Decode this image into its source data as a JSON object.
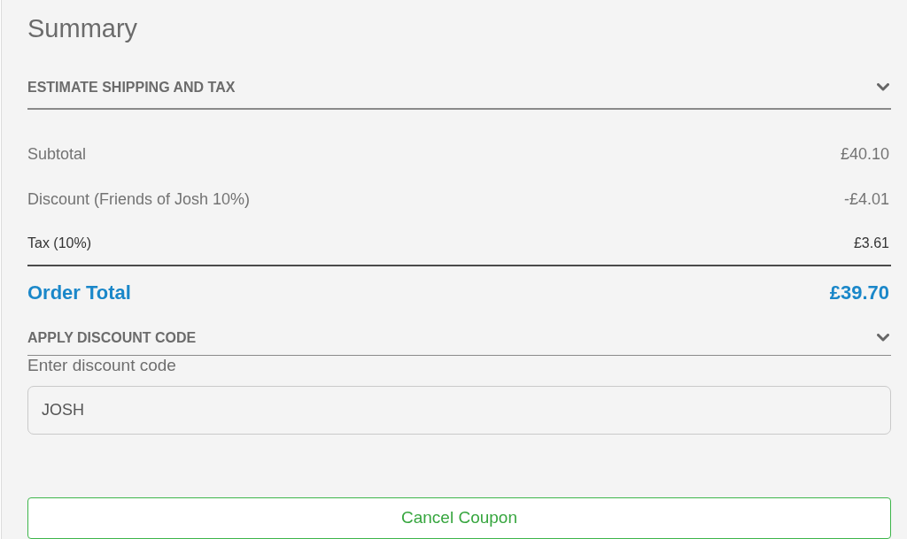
{
  "title": "Summary",
  "shipping_section": {
    "title": "ESTIMATE SHIPPING AND TAX"
  },
  "totals": [
    {
      "label": "Subtotal",
      "amount": "£40.10"
    },
    {
      "label": "Discount (Friends of Josh 10%)",
      "amount": "-£4.01"
    },
    {
      "label": "Tax (10%)",
      "amount": "£3.61"
    }
  ],
  "order_total": {
    "label": "Order Total",
    "amount": "£39.70"
  },
  "discount_section": {
    "title": "APPLY DISCOUNT CODE",
    "field": {
      "label": "Enter discount code",
      "value": "JOSH"
    }
  },
  "buttons": [
    {
      "label": "Cancel Coupon"
    }
  ]
}
